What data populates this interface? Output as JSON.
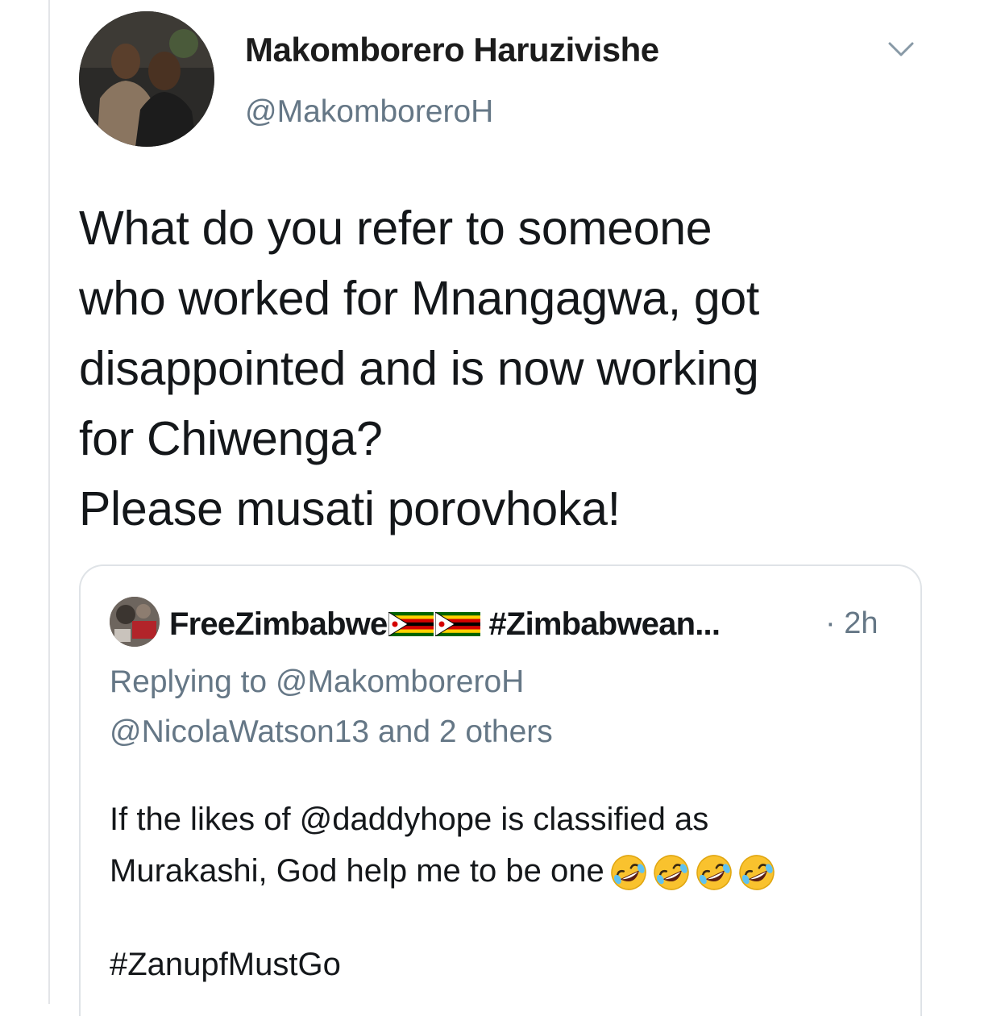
{
  "tweet": {
    "author_name": "Makomborero Haruzivishe",
    "author_handle": "@MakomboreroH",
    "text_lines": [
      "What do you refer to someone",
      "who worked for Mnangagwa, got",
      "disappointed and is now working",
      "for Chiwenga?",
      "Please musati porovhoka!"
    ],
    "menu_icon": "chevron-down-icon"
  },
  "quoted_tweet": {
    "author_name": "FreeZimbabwe",
    "name_emoji": [
      "zimbabwe-flag",
      "zimbabwe-flag"
    ],
    "hashtag_truncated": "#Zimbabwean...",
    "time": "· 2h",
    "replying_to": "Replying to @MakomboreroH",
    "reply_others": "@NicolaWatson13 and 2 others",
    "body_lines": [
      "If the likes of @daddyhope is classified as",
      "Murakashi, God help me to be one"
    ],
    "body_emoji": [
      "rolling-on-floor-laughing-emoji",
      "rolling-on-floor-laughing-emoji",
      "rolling-on-floor-laughing-emoji",
      "rolling-on-floor-laughing-emoji"
    ],
    "hashtag_line": "#ZanupfMustGo"
  },
  "colors": {
    "text_primary": "#14171a",
    "text_secondary": "#657786",
    "border": "#dfe3e7",
    "background": "#ffffff"
  }
}
